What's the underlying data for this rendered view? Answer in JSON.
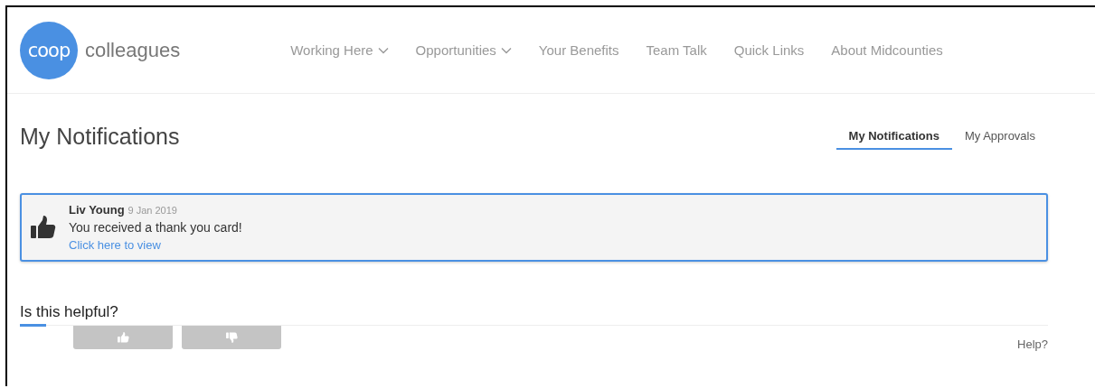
{
  "header": {
    "logo_text": "coop",
    "brand": "colleagues",
    "nav": [
      {
        "label": "Working Here",
        "dropdown": true
      },
      {
        "label": "Opportunities",
        "dropdown": true
      },
      {
        "label": "Your Benefits",
        "dropdown": false
      },
      {
        "label": "Team Talk",
        "dropdown": false
      },
      {
        "label": "Quick Links",
        "dropdown": false
      },
      {
        "label": "About Midcounties",
        "dropdown": false
      }
    ]
  },
  "page": {
    "title": "My Notifications",
    "tabs": [
      {
        "label": "My Notifications",
        "selected": true
      },
      {
        "label": "My Approvals",
        "selected": false
      }
    ]
  },
  "notifications": [
    {
      "sender": "Liv Young",
      "date": "9 Jan 2019",
      "message": "You received a thank you card!",
      "link": "Click here to view"
    }
  ],
  "feedback": {
    "question": "Is this helpful?",
    "buttons": [
      {
        "kind": "up"
      },
      {
        "kind": "down"
      }
    ],
    "help": "Help?"
  }
}
